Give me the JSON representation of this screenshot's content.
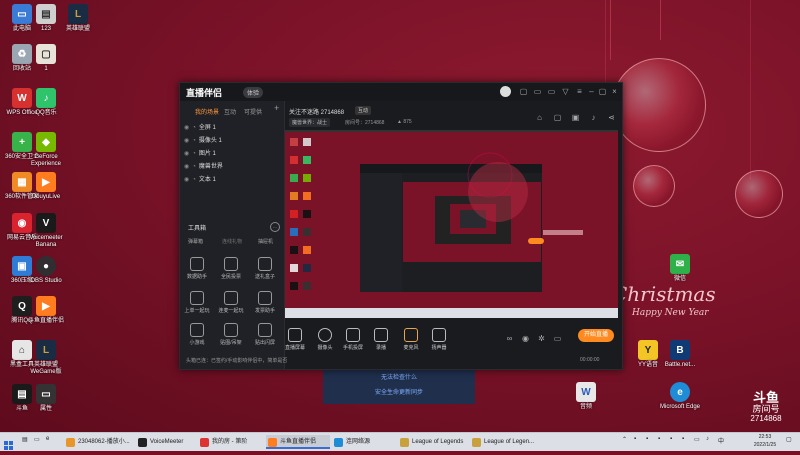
{
  "desktop_icons": [
    {
      "label": "此电脑",
      "color": "#3a7bd5",
      "glyph": "▭"
    },
    {
      "label": "123",
      "color": "#cfcfcf",
      "glyph": "▤"
    },
    {
      "label": "英雄联盟",
      "color": "#1a2b44",
      "glyph": "L"
    },
    {
      "label": "回收站",
      "color": "#9aa6b2",
      "glyph": "♻"
    },
    {
      "label": "1",
      "color": "#e8e3d8",
      "glyph": "▢"
    },
    {
      "label": "WPS Office",
      "color": "#d6302f",
      "glyph": "W"
    },
    {
      "label": "QQ音乐",
      "color": "#2fc36b",
      "glyph": "♪"
    },
    {
      "label": "360安全卫士",
      "color": "#37b34a",
      "glyph": "+"
    },
    {
      "label": "GeForce Experience",
      "color": "#76b900",
      "glyph": "◆"
    },
    {
      "label": "360软件管家",
      "color": "#f08a24",
      "glyph": "▦"
    },
    {
      "label": "DouyuLive",
      "color": "#ff7c1f",
      "glyph": "▶"
    },
    {
      "label": "网易云音乐",
      "color": "#d9232e",
      "glyph": "◉"
    },
    {
      "label": "Voicemeeter Banana",
      "color": "#1a1a1a",
      "glyph": "V"
    },
    {
      "label": "360压缩",
      "color": "#2e7cd6",
      "glyph": "▣"
    },
    {
      "label": "OBS Studio",
      "color": "#302e31",
      "glyph": "●"
    },
    {
      "label": "腾讯QQ",
      "color": "#1e1e1e",
      "glyph": "Q"
    },
    {
      "label": "斗鱼直播伴侣",
      "color": "#ff7c1f",
      "glyph": "▶"
    },
    {
      "label": "黑盒工具",
      "color": "#e6e6e6",
      "glyph": "⌂"
    },
    {
      "label": "英雄联盟WeGame版",
      "color": "#1a2b44",
      "glyph": "L"
    },
    {
      "label": "斗鱼",
      "color": "#1a1a1a",
      "glyph": "▤"
    },
    {
      "label": "属性",
      "color": "#333",
      "glyph": "▭"
    },
    {
      "label": "微信",
      "color": "#2fb14a",
      "glyph": "✉"
    },
    {
      "label": "YY语音",
      "color": "#f3c625",
      "glyph": "Y"
    },
    {
      "label": "Battle.net...",
      "color": "#0f3a73",
      "glyph": "B"
    },
    {
      "label": "音频",
      "color": "#e8e8e8",
      "glyph": "W"
    },
    {
      "label": "Microsoft Edge",
      "color": "#1e8cd6",
      "glyph": "e"
    }
  ],
  "wallpaper": {
    "line1": "Christmas",
    "line2": "Happy New Year"
  },
  "app": {
    "logo": "直播伴侣",
    "vip": "体验",
    "left_tabs": [
      "我的场景",
      "互动",
      "可提供"
    ],
    "scenes": [
      "全屏 1",
      "摄像头 1",
      "图片 1",
      "魔兽世界",
      "文本 1"
    ],
    "toolbox_title": "工具箱",
    "toolbox_sub": [
      "弹幕箱",
      "连线礼物",
      "抽屉机"
    ],
    "tools": [
      "数据助手",
      "全民投票",
      "送礼盒子",
      "上单一起玩",
      "连麦一起玩",
      "发票助手",
      "小游戏",
      "贴图/吊架",
      "贴出闪屏"
    ],
    "status": "头箱已连：已签约/手动影响伴侣中，简单是否",
    "stream_title": "关注不迷路 2714868",
    "stream_tag": "互动",
    "category": "魔兽世界：战士",
    "room_label": "房间号：2714868",
    "fans": "875",
    "bottom_buttons": [
      "直播屏幕",
      "摄像头",
      "手机投屏",
      "录播",
      "麦克风",
      "扬声器"
    ],
    "start_button": "开始直播",
    "timer": "00:00:00"
  },
  "dialog": {
    "line1": "无法检查什么",
    "line2": "安全生命更新同步"
  },
  "taskbar": {
    "items": [
      {
        "label": "23048062-播放小...",
        "color": "#e8962a"
      },
      {
        "label": "VoiceMeeter",
        "color": "#222"
      },
      {
        "label": "我的房 - 第阶",
        "color": "#d33"
      },
      {
        "label": "斗鱼直播伴侣",
        "color": "#ff7c1f"
      },
      {
        "label": "连网络源",
        "color": "#1e8cd6"
      },
      {
        "label": "League of Legends",
        "color": "#c8a13c"
      },
      {
        "label": "League of Legen...",
        "color": "#c8a13c"
      }
    ],
    "time": "22:53",
    "date": "2022/1/25"
  },
  "watermark": {
    "name": "斗鱼",
    "sub": "房间号",
    "room": "2714868"
  }
}
